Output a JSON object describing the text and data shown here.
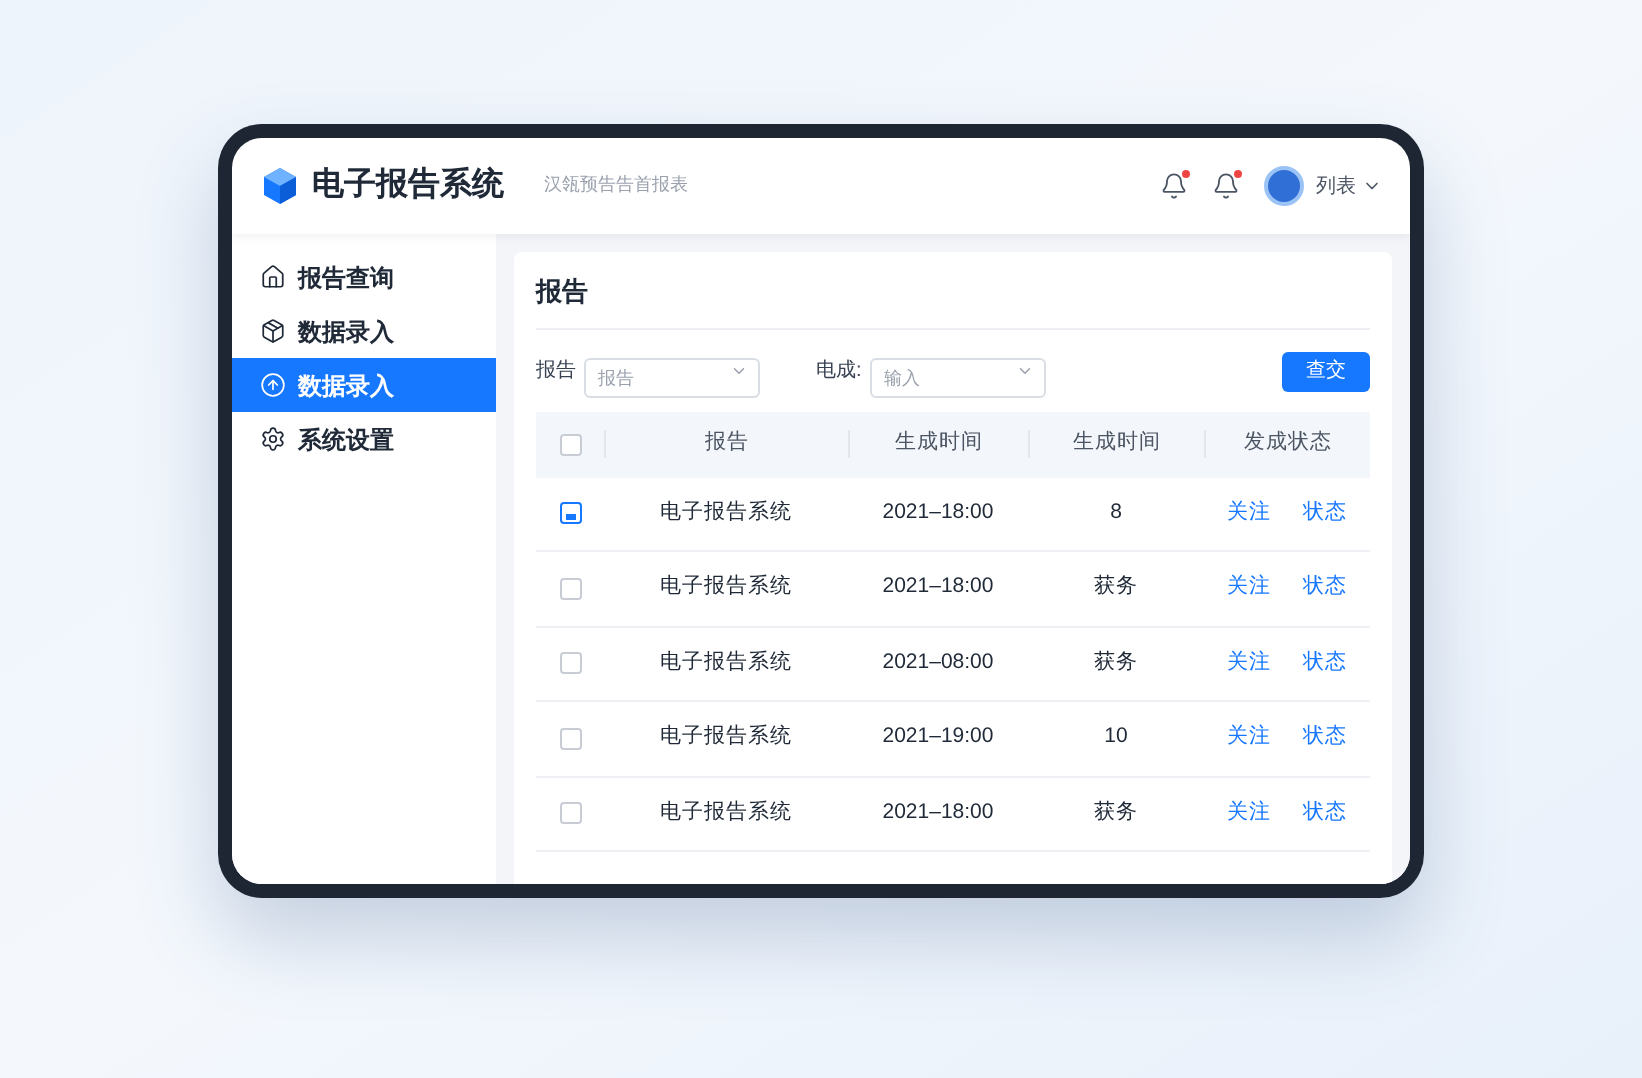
{
  "app": {
    "title": "电子报告系统",
    "subtitle": "汉瓴预告告首报表"
  },
  "header": {
    "user_label": "列表",
    "notifications": [
      {
        "unread": true
      },
      {
        "unread": true
      }
    ]
  },
  "sidebar": {
    "items": [
      {
        "label": "报告查询",
        "selected": false
      },
      {
        "label": "数据录入",
        "selected": false
      },
      {
        "label": "数据录入",
        "selected": true
      },
      {
        "label": "系统设置",
        "selected": false
      }
    ]
  },
  "panel": {
    "title": "报告",
    "filters": [
      {
        "label": "报告",
        "placeholder": "报告"
      },
      {
        "label": "电成:",
        "placeholder": "输入"
      }
    ],
    "submit": "查交"
  },
  "table": {
    "columns": [
      "报告",
      "生成时间",
      "生成时间",
      "发成状态"
    ],
    "header_checked": false,
    "rows": [
      {
        "checked": true,
        "cells": [
          "电子报告系统",
          "2021–18:00",
          "8"
        ],
        "actions": [
          "关注",
          "状态"
        ]
      },
      {
        "checked": false,
        "cells": [
          "电子报告系统",
          "2021–18:00",
          "获务"
        ],
        "actions": [
          "关注",
          "状态"
        ]
      },
      {
        "checked": false,
        "cells": [
          "电子报告系统",
          "2021–08:00",
          "获务"
        ],
        "actions": [
          "关注",
          "状态"
        ]
      },
      {
        "checked": false,
        "cells": [
          "电子报告系统",
          "2021–19:00",
          "10"
        ],
        "actions": [
          "关注",
          "状态"
        ]
      },
      {
        "checked": false,
        "cells": [
          "电子报告系统",
          "2021–18:00",
          "获务"
        ],
        "actions": [
          "关注",
          "状态"
        ]
      }
    ]
  }
}
